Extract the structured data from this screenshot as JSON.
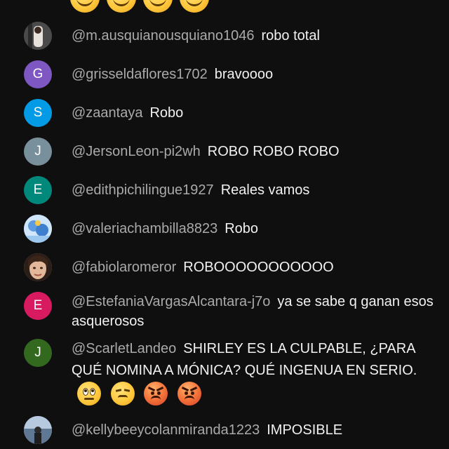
{
  "comments": [
    {
      "author": "@m.ausquianousquiano1046",
      "message": "robo total",
      "avatar_type": "photo",
      "avatar_color": "#6b6b6b"
    },
    {
      "author": "@grisseldaflores1702",
      "message": "bravoooo",
      "avatar_letter": "G",
      "avatar_color": "#7e57c2"
    },
    {
      "author": "@zaantaya",
      "message": "Robo",
      "avatar_letter": "S",
      "avatar_color": "#039be5"
    },
    {
      "author": "@JersonLeon-pi2wh",
      "message": "ROBO ROBO ROBO",
      "avatar_letter": "J",
      "avatar_color": "#78909c"
    },
    {
      "author": "@edithpichilingue1927",
      "message": "Reales vamos",
      "avatar_letter": "E",
      "avatar_color": "#00897b"
    },
    {
      "author": "@valeriachambilla8823",
      "message": "Robo",
      "avatar_type": "photo",
      "avatar_color": "#7fb6e8"
    },
    {
      "author": "@fabiolaromeror",
      "message": "ROBOOOOOOOOOOO",
      "avatar_type": "photo",
      "avatar_color": "#c9a590"
    },
    {
      "author": "@EstefaniaVargasAlcantara-j7o",
      "message": "ya se sabe q ganan esos asquerosos",
      "avatar_letter": "E",
      "avatar_color": "#d81b60"
    },
    {
      "author": "@ScarletLandeo",
      "message": "SHIRLEY ES LA CULPABLE, ¿PARA QUÉ NOMINA A MÓNICA? QUÉ INGENUA EN SERIO.",
      "avatar_letter": "J",
      "avatar_color": "#33691e",
      "emojis": [
        "face-with-rolling-eyes",
        "unamused-face",
        "angry-face",
        "angry-face"
      ]
    },
    {
      "author": "@kellybeeycolanmiranda1223",
      "message": "IMPOSIBLE",
      "avatar_type": "photo",
      "avatar_color": "#8aa4c4"
    }
  ],
  "top_emojis": [
    "grinning-face",
    "grinning-face",
    "grinning-face",
    "grinning-face"
  ]
}
